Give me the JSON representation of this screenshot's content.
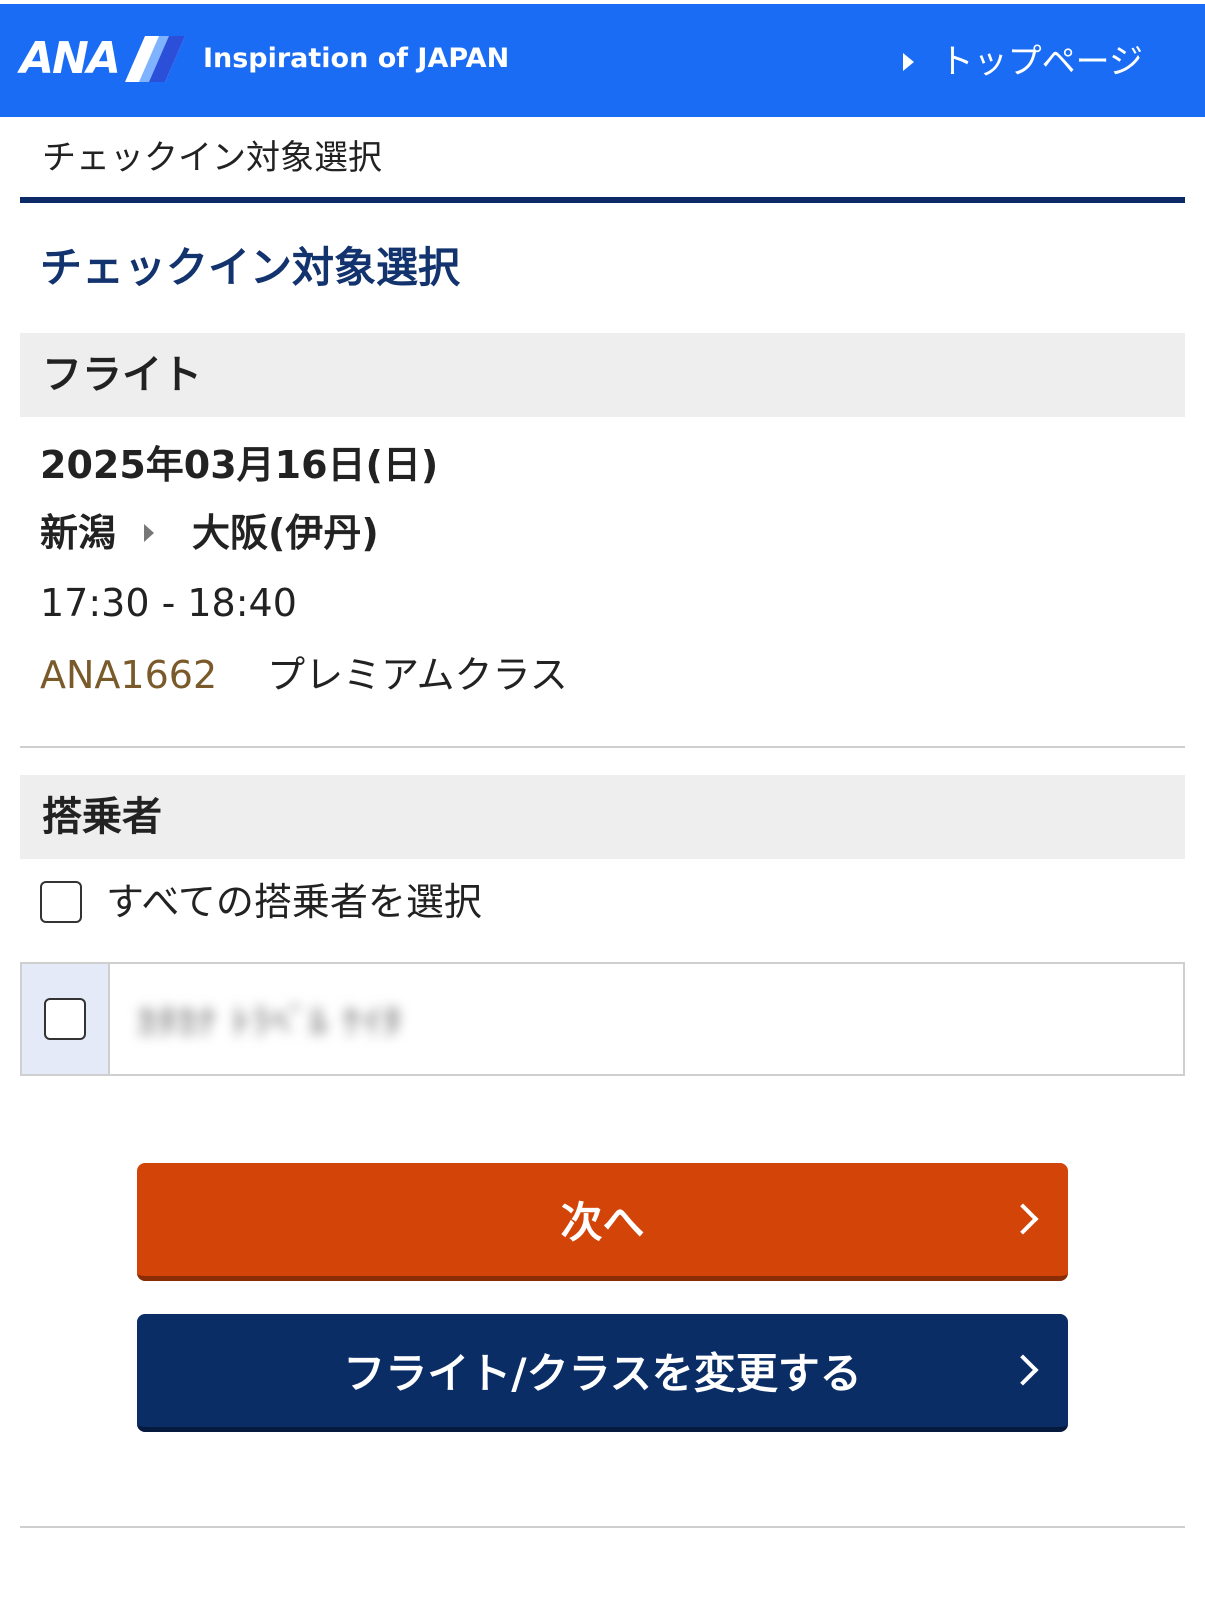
{
  "header": {
    "logo_text": "ANA",
    "tagline": "Inspiration of JAPAN",
    "top_link": "トップページ",
    "background_color": "#1a6cf5"
  },
  "breadcrumb": {
    "label": "チェックイン対象選択"
  },
  "page_title": "チェックイン対象選択",
  "flight_section": {
    "heading": "フライト",
    "date": "2025年03月16日(日)",
    "origin": "新潟",
    "destination": "大阪(伊丹)",
    "times": "17:30 - 18:40",
    "flight_number": "ANA1662",
    "cabin_class": "プレミアムクラス"
  },
  "passenger_section": {
    "heading": "搭乗者",
    "select_all_label": "すべての搭乗者を選択",
    "passengers": [
      {
        "name": "ｶﾀｶﾅ ﾄﾗﾍﾞﾙ ｹｲﾀ",
        "checked": false
      }
    ],
    "select_all_checked": false
  },
  "actions": {
    "next_label": "次へ",
    "change_label": "フライト/クラスを変更する",
    "next_color": "#d34408",
    "change_color": "#0a2d66"
  },
  "icons": {
    "top_link_icon": "triangle-right-icon",
    "route_icon": "triangle-right-icon",
    "button_icon": "chevron-right-icon"
  }
}
